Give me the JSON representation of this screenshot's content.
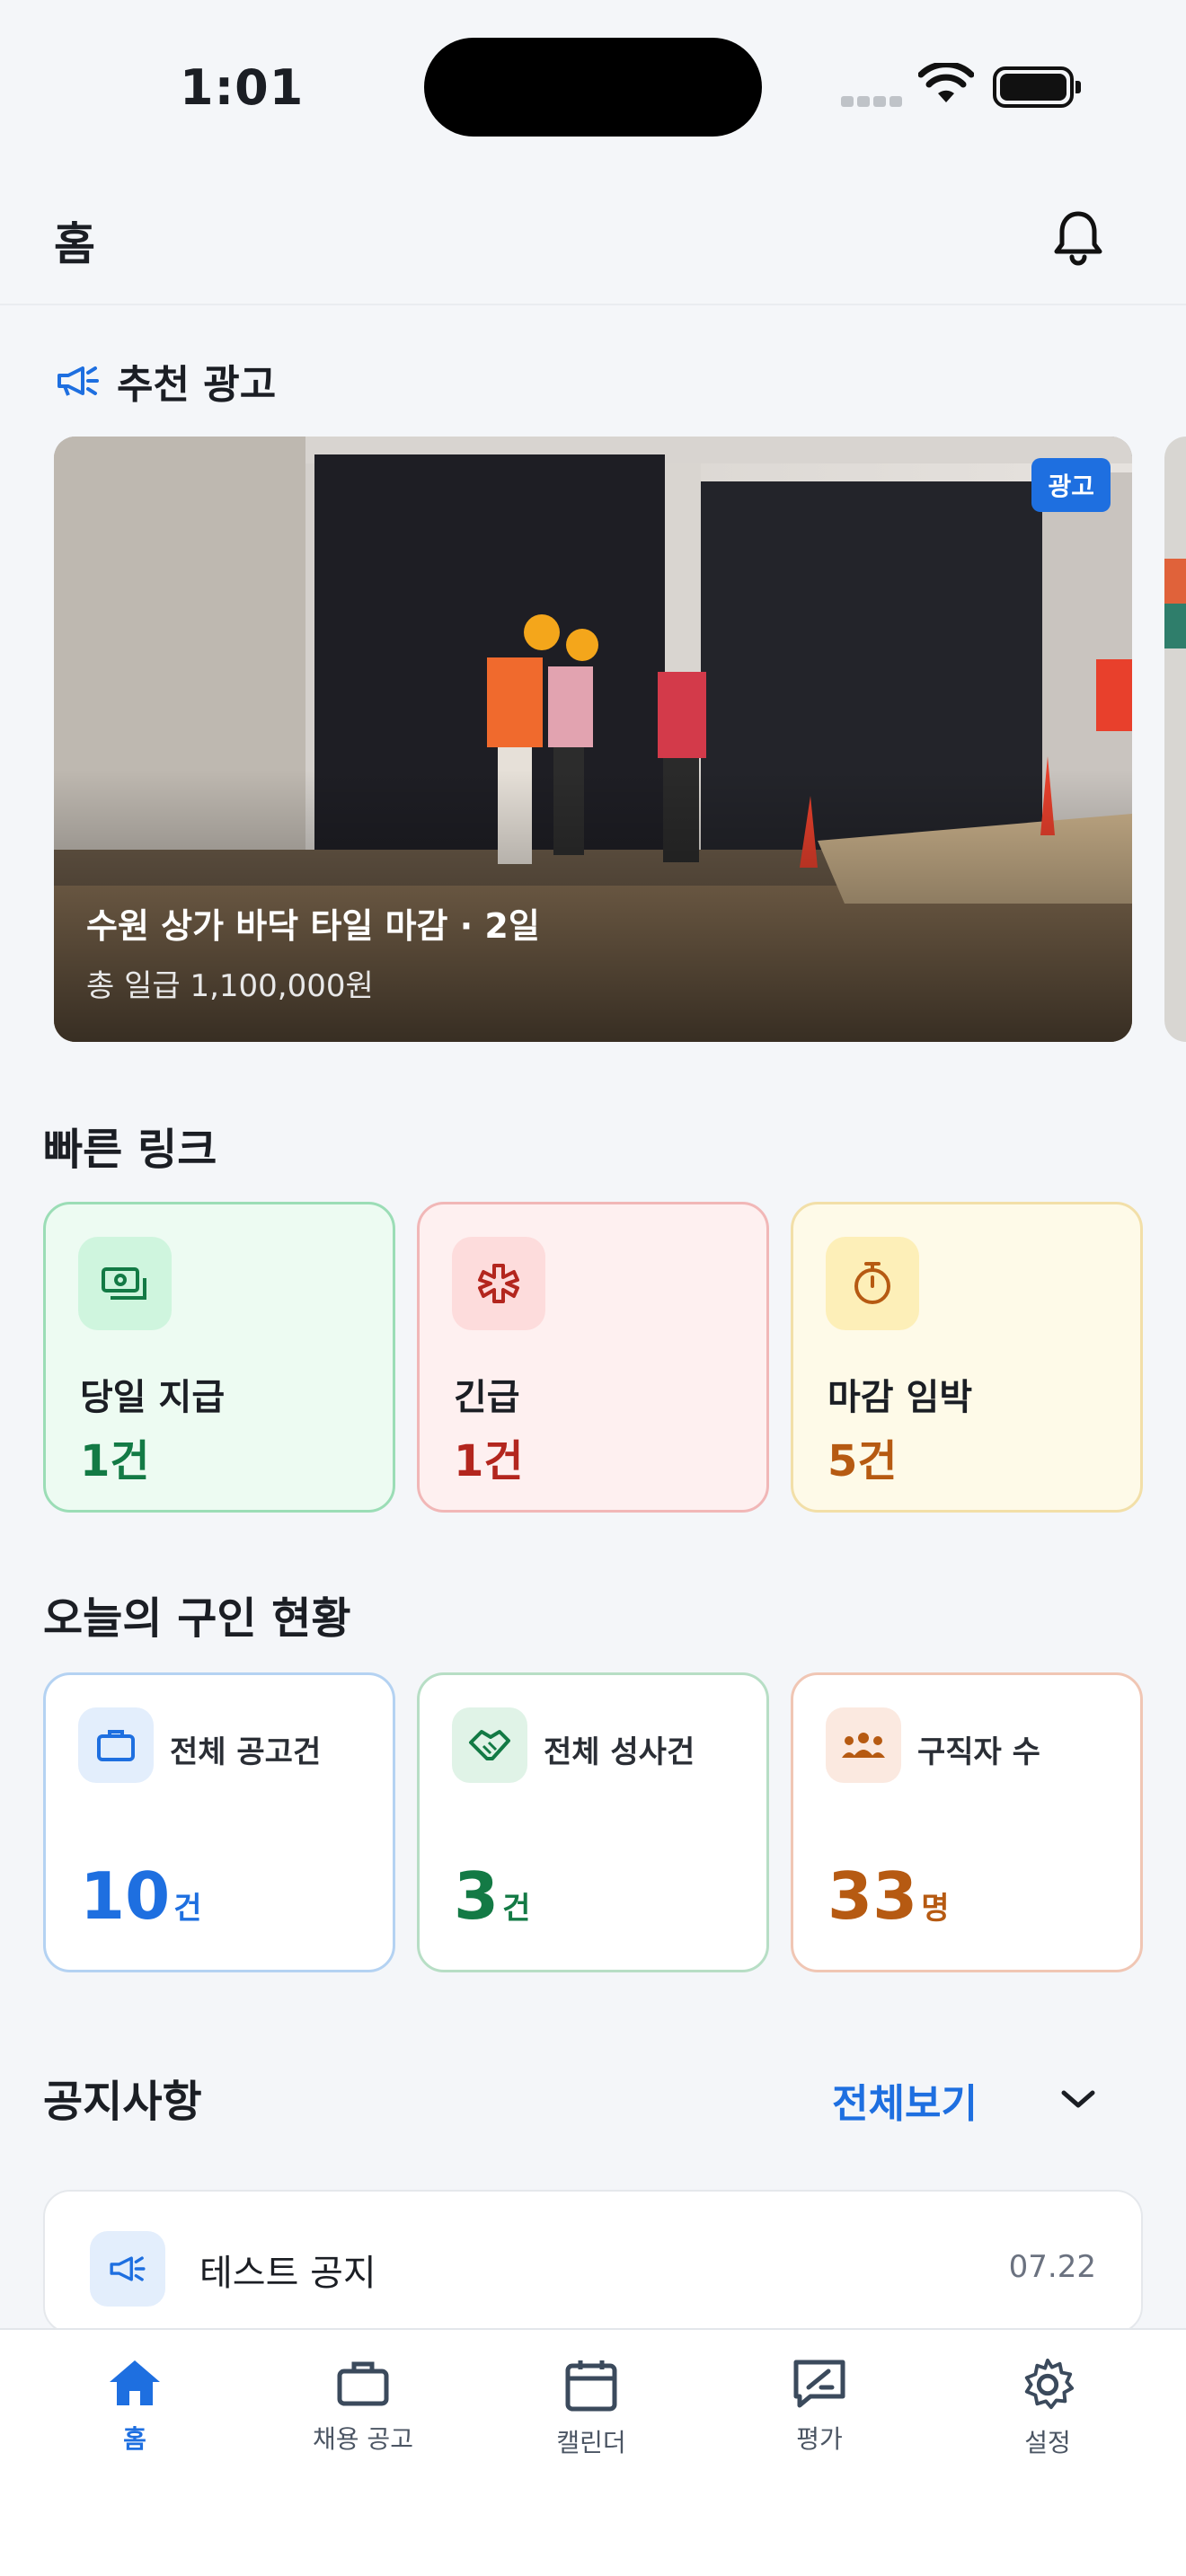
{
  "status_bar": {
    "time": "1:01"
  },
  "header": {
    "title": "홈"
  },
  "ads": {
    "section_title": "추천 광고",
    "badge": "광고",
    "title": "수원 상가 바닥 타일 마감 · 2일",
    "subtitle": "총 일급 1,100,000원"
  },
  "quick_links": {
    "title": "빠른 링크",
    "items": [
      {
        "label": "당일 지급",
        "count": "1건",
        "icon": "cash-icon",
        "color": "#137A45"
      },
      {
        "label": "긴급",
        "count": "1건",
        "icon": "emergency-icon",
        "color": "#B3261E"
      },
      {
        "label": "마감 임박",
        "count": "5건",
        "icon": "timer-icon",
        "color": "#B65A12"
      }
    ]
  },
  "today_status": {
    "title": "오늘의 구인 현황",
    "items": [
      {
        "label": "전체 공고건",
        "value": "10",
        "unit": "건",
        "icon": "briefcase-icon",
        "color": "#1E6FE0"
      },
      {
        "label": "전체 성사건",
        "value": "3",
        "unit": "건",
        "icon": "handshake-icon",
        "color": "#137A45"
      },
      {
        "label": "구직자 수",
        "value": "33",
        "unit": "명",
        "icon": "group-icon",
        "color": "#B65A12"
      }
    ]
  },
  "notices": {
    "title": "공지사항",
    "see_all": "전체보기",
    "items": [
      {
        "title": "테스트 공지",
        "date": "07.22"
      }
    ]
  },
  "tabbar": {
    "items": [
      {
        "label": "홈",
        "icon": "home-icon",
        "active": true
      },
      {
        "label": "채용 공고",
        "icon": "briefcase-icon"
      },
      {
        "label": "캘린더",
        "icon": "calendar-icon"
      },
      {
        "label": "평가",
        "icon": "review-icon"
      },
      {
        "label": "설정",
        "icon": "gear-icon"
      }
    ]
  },
  "colors": {
    "accent": "#1E6FE0",
    "background": "#F4F6F9"
  }
}
